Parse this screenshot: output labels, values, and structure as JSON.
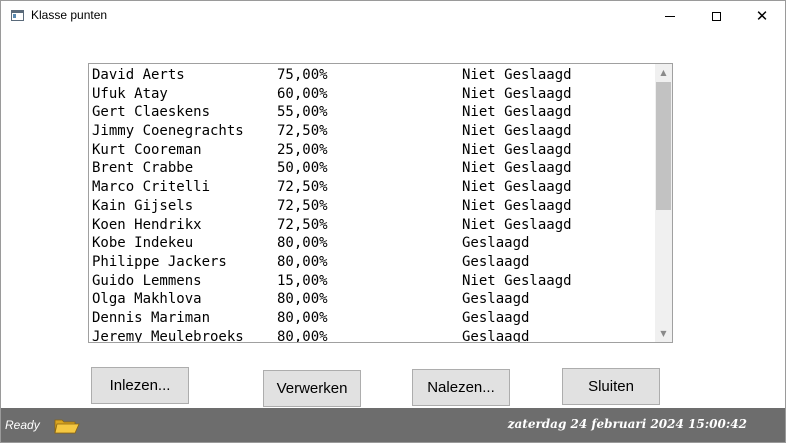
{
  "window": {
    "title": "Klasse punten",
    "icons": {
      "app": "window-app-icon",
      "minimize": "minimize-icon",
      "maximize": "maximize-icon",
      "close": "close-icon"
    },
    "close_glyph": "✕"
  },
  "list": {
    "rows": [
      {
        "name": "David Aerts",
        "percent": "75,00%",
        "result": "Niet Geslaagd"
      },
      {
        "name": "Ufuk Atay",
        "percent": "60,00%",
        "result": "Niet Geslaagd"
      },
      {
        "name": "Gert Claeskens",
        "percent": "55,00%",
        "result": "Niet Geslaagd"
      },
      {
        "name": "Jimmy Coenegrachts",
        "percent": "72,50%",
        "result": "Niet Geslaagd"
      },
      {
        "name": "Kurt Cooreman",
        "percent": "25,00%",
        "result": "Niet Geslaagd"
      },
      {
        "name": "Brent Crabbe",
        "percent": "50,00%",
        "result": "Niet Geslaagd"
      },
      {
        "name": "Marco Critelli",
        "percent": "72,50%",
        "result": "Niet Geslaagd"
      },
      {
        "name": "Kain Gijsels",
        "percent": "72,50%",
        "result": "Niet Geslaagd"
      },
      {
        "name": "Koen Hendrikx",
        "percent": "72,50%",
        "result": "Niet Geslaagd"
      },
      {
        "name": "Kobe Indekeu",
        "percent": "80,00%",
        "result": "Geslaagd"
      },
      {
        "name": "Philippe Jackers",
        "percent": "80,00%",
        "result": "Geslaagd"
      },
      {
        "name": "Guido Lemmens",
        "percent": "15,00%",
        "result": "Niet Geslaagd"
      },
      {
        "name": "Olga Makhlova",
        "percent": "80,00%",
        "result": "Geslaagd"
      },
      {
        "name": "Dennis Mariman",
        "percent": "80,00%",
        "result": "Geslaagd"
      },
      {
        "name": "Jeremy Meulebroeks",
        "percent": "80,00%",
        "result": "Geslaagd"
      }
    ],
    "scroll_up_glyph": "▲",
    "scroll_down_glyph": "▼"
  },
  "buttons": {
    "inlezen": "Inlezen...",
    "verwerken": "Verwerken",
    "nalezen": "Nalezen...",
    "sluiten": "Sluiten"
  },
  "statusbar": {
    "ready": "Ready",
    "icon": "folder-open-icon",
    "datetime": "zaterdag 24 februari 2024 15:00:42"
  }
}
